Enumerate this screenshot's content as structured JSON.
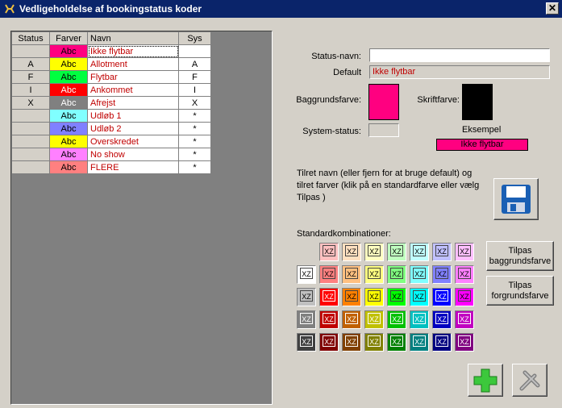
{
  "window": {
    "title": "Vedligeholdelse af bookingstatus koder"
  },
  "grid": {
    "headers": [
      "Status",
      "Farver",
      "Navn",
      "Sys"
    ],
    "rows": [
      {
        "status": "",
        "farve": "Abc",
        "bg": "#ff0080",
        "fg": "#000000",
        "navn": "Ikke flytbar",
        "sys": ""
      },
      {
        "status": "A",
        "farve": "Abc",
        "bg": "#ffff00",
        "fg": "#000000",
        "navn": "Allotment",
        "sys": "A"
      },
      {
        "status": "F",
        "farve": "Abc",
        "bg": "#00ff40",
        "fg": "#000000",
        "navn": "Flytbar",
        "sys": "F"
      },
      {
        "status": "I",
        "farve": "Abc",
        "bg": "#ff0000",
        "fg": "#ffffff",
        "navn": "Ankommet",
        "sys": "I"
      },
      {
        "status": "X",
        "farve": "Abc",
        "bg": "#808080",
        "fg": "#ffffff",
        "navn": "Afrejst",
        "sys": "X"
      },
      {
        "status": "",
        "farve": "Abc",
        "bg": "#80ffff",
        "fg": "#000000",
        "navn": "Udløb 1",
        "sys": "*"
      },
      {
        "status": "",
        "farve": "Abc",
        "bg": "#8080ff",
        "fg": "#000000",
        "navn": "Udløb 2",
        "sys": "*"
      },
      {
        "status": "",
        "farve": "Abc",
        "bg": "#ffff00",
        "fg": "#000000",
        "navn": "Overskredet",
        "sys": "*"
      },
      {
        "status": "",
        "farve": "Abc",
        "bg": "#ff80ff",
        "fg": "#000000",
        "navn": "No show",
        "sys": "*"
      },
      {
        "status": "",
        "farve": "Abc",
        "bg": "#ff8080",
        "fg": "#000000",
        "navn": "FLERE",
        "sys": "*"
      }
    ]
  },
  "form": {
    "status_navn_label": "Status-navn:",
    "status_navn_value": "",
    "default_label": "Default",
    "default_value": "Ikke flytbar",
    "baggrund_label": "Baggrundsfarve:",
    "baggrund_color": "#ff0080",
    "skrift_label": "Skriftfarve:",
    "skrift_color": "#000000",
    "system_status_label": "System-status:",
    "system_status_value": "",
    "eksempel_label": "Eksempel",
    "eksempel_text": "Ikke flytbar",
    "hint": "Tilret navn (eller fjern for at bruge default) og tilret farver (klik på en standardfarve eller vælg Tilpas )",
    "std_label": "Standardkombinationer:"
  },
  "buttons": {
    "tilpas_bg": "Tilpas baggrundsfarve",
    "tilpas_fg": "Tilpas forgrundsfarve"
  },
  "palette": {
    "swatch_text": "XZ",
    "rows": [
      [
        "",
        "#ffc0c0",
        "#ffe0c0",
        "#ffffc0",
        "#c0ffc0",
        "#c0ffff",
        "#c0c0ff",
        "#ffc0ff"
      ],
      [
        "#ffffff",
        "#ff8080",
        "#ffc080",
        "#ffff80",
        "#80ff80",
        "#80ffff",
        "#8080ff",
        "#ff80ff"
      ],
      [
        "#c0c0c0",
        "#ff0000",
        "#ff8000",
        "#ffff00",
        "#00ff00",
        "#00ffff",
        "#0000ff",
        "#ff00ff"
      ],
      [
        "#808080",
        "#c00000",
        "#c06000",
        "#c0c000",
        "#00c000",
        "#00c0c0",
        "#0000c0",
        "#c000c0"
      ],
      [
        "#404040",
        "#800000",
        "#804000",
        "#808000",
        "#008000",
        "#008080",
        "#000080",
        "#800080"
      ]
    ]
  }
}
